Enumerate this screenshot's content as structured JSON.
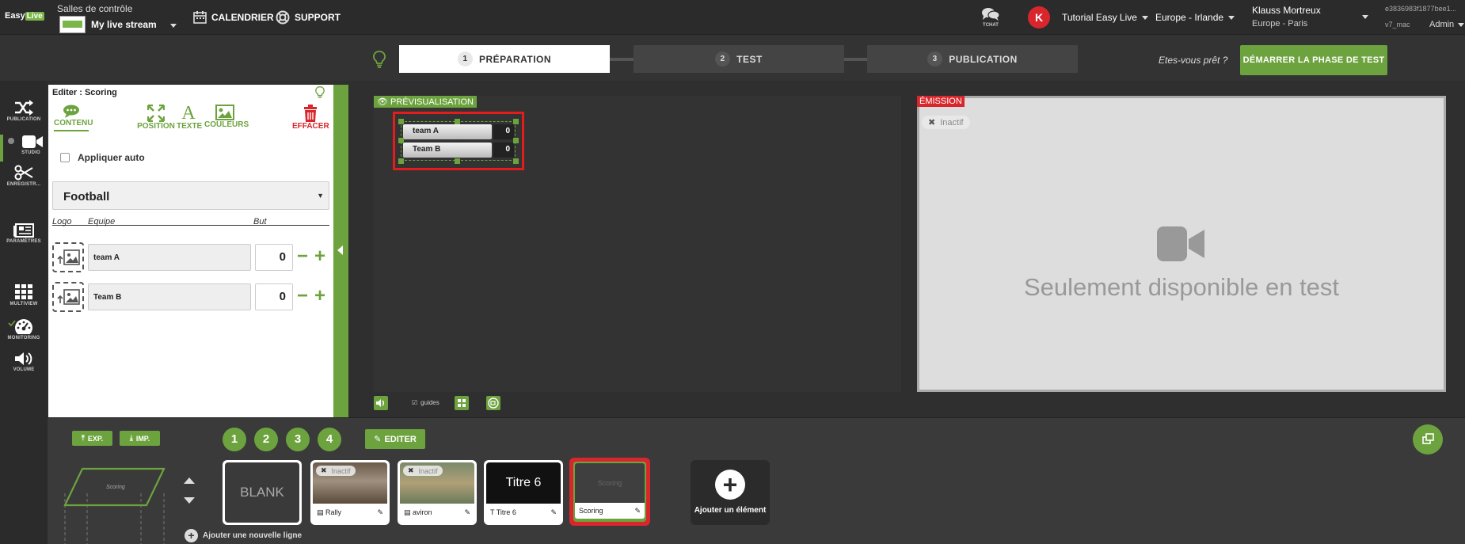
{
  "topbar": {
    "logo_easy": "Easy",
    "logo_live": "Live",
    "room_title": "Salles de contrôle",
    "room_name": "My live stream",
    "nav_calendar": "CALENDRIER",
    "nav_support": "SUPPORT",
    "tchat_label": "TCHAT",
    "avatar_letter": "K",
    "account": "Tutorial Easy Live",
    "region": "Europe - Irlande",
    "user_name": "Klauss Mortreux",
    "user_zone": "Europe - Paris",
    "hash": "e3836983f1877bee1...",
    "version": "v7_mac",
    "role": "Admin"
  },
  "steps": [
    {
      "num": "1",
      "label": "PRÉPARATION",
      "active": true
    },
    {
      "num": "2",
      "label": "TEST",
      "active": false
    },
    {
      "num": "3",
      "label": "PUBLICATION",
      "active": false
    }
  ],
  "ready_text": "Etes-vous prêt ?",
  "start_button": "DÉMARRER LA PHASE DE TEST",
  "sidebar": {
    "publication": "PUBLICATION",
    "studio": "STUDIO",
    "enregistrement": "ENREGISTR...",
    "parametres": "PARAMÈTRES",
    "multiview": "MULTIVIEW",
    "monitoring": "MONITORING",
    "volume": "VOLUME"
  },
  "editor": {
    "title": "Editer : Scoring",
    "tools": {
      "contenu": "CONTENU",
      "position": "POSITION",
      "texte": "TEXTE",
      "couleurs": "COULEURS",
      "effacer": "EFFACER"
    },
    "auto_apply": "Appliquer auto",
    "sport": "Football",
    "headers": {
      "logo": "Logo",
      "team": "Equipe",
      "goal": "But"
    },
    "teams": [
      {
        "name": "team A",
        "score": "0"
      },
      {
        "name": "Team B",
        "score": "0"
      }
    ]
  },
  "preview": {
    "label": "PRÉVISUALISATION",
    "guides": "guides",
    "scoreboard": [
      {
        "name": "team A",
        "score": "0"
      },
      {
        "name": "Team B",
        "score": "0"
      }
    ]
  },
  "emission": {
    "label": "ÉMISSION",
    "status": "Inactif",
    "message": "Seulement disponible en test"
  },
  "bottom": {
    "exp": "EXP.",
    "imp": "IMP.",
    "layout_thumb_label": "Scoring",
    "numbers": [
      "1",
      "2",
      "3",
      "4"
    ],
    "edit": "EDITER",
    "add_line": "Ajouter une nouvelle ligne",
    "add_element": "Ajouter un élément",
    "elements": [
      {
        "title": "BLANK",
        "caption": ""
      },
      {
        "title": "",
        "caption": "Rally",
        "status": "Inactif"
      },
      {
        "title": "",
        "caption": "aviron",
        "status": "Inactif"
      },
      {
        "title": "Titre 6",
        "caption": "Titre 6"
      },
      {
        "title": "Scoring",
        "caption": "Scoring"
      }
    ]
  },
  "colors": {
    "accent_green": "#6da33e",
    "alert_red": "#d9262c",
    "bg_dark": "#2f2f2f"
  }
}
